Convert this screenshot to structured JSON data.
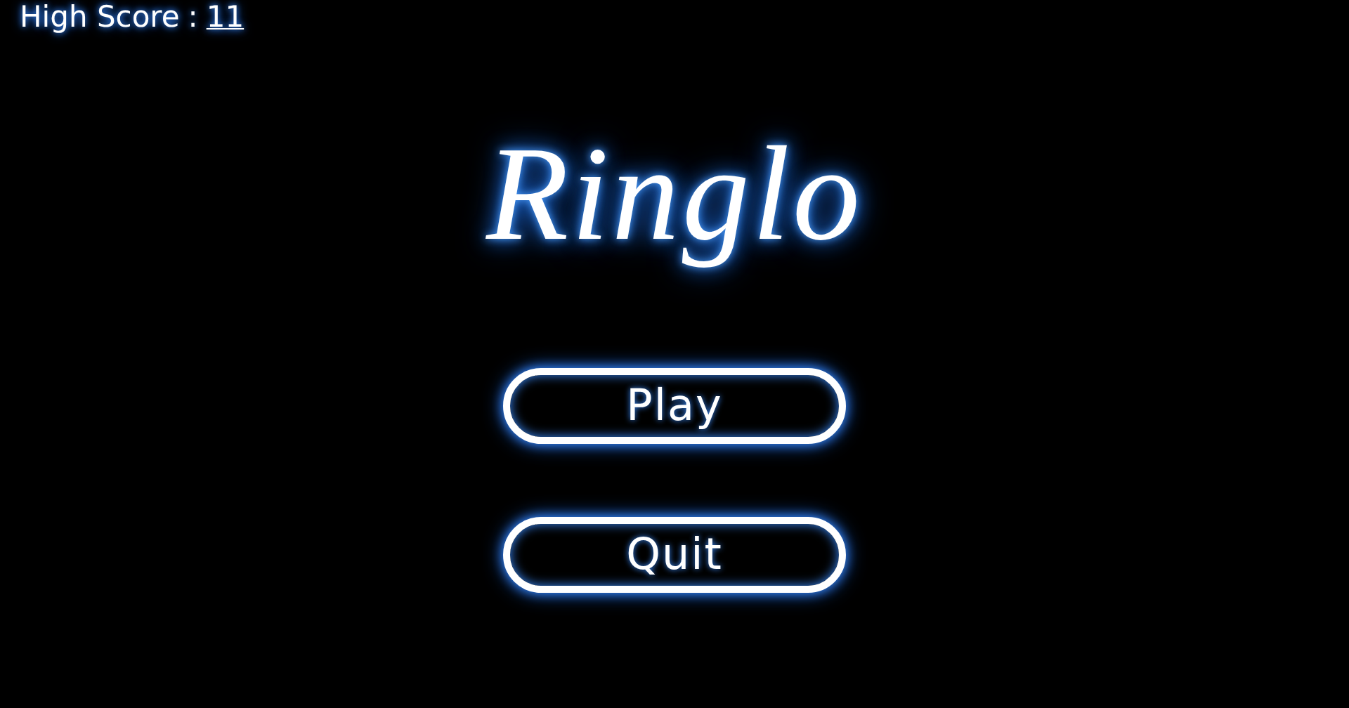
{
  "high_score": {
    "label": "High Score",
    "separator": ":",
    "value": "11"
  },
  "title": "Ringlo",
  "buttons": [
    "Play",
    "Quit"
  ]
}
